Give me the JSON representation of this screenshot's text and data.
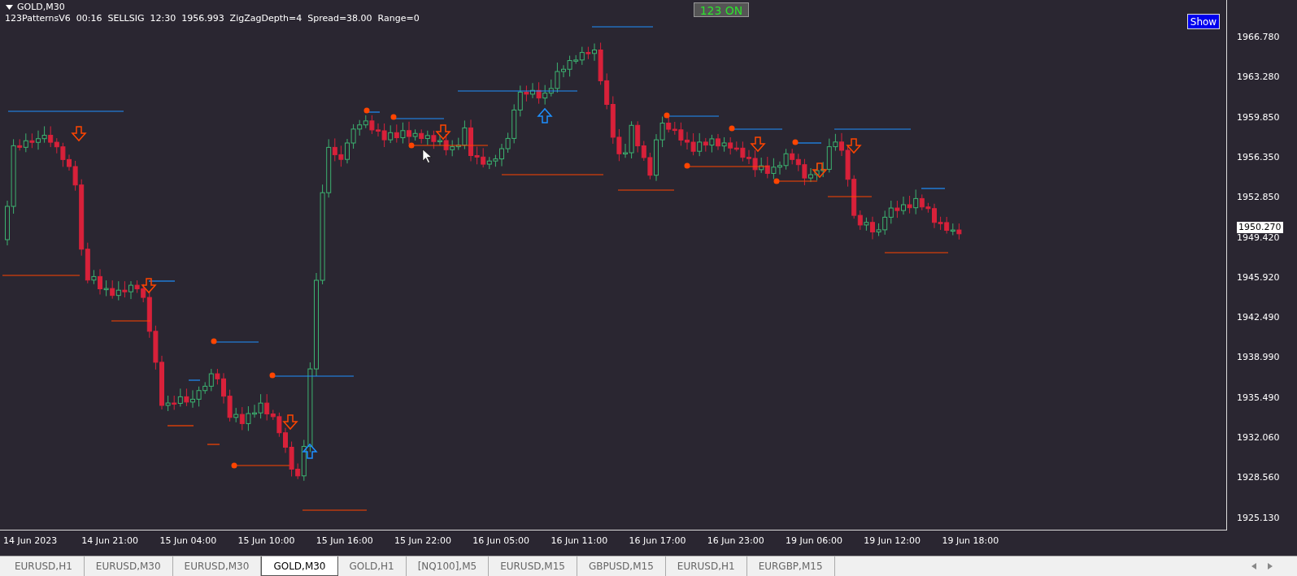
{
  "chart": {
    "symbol": "GOLD,M30",
    "indicator_line": "123PatternsV6  00:16  SELLSIG  12:30  1956.993  ZigZagDepth=4  Spread=38.00  Range=0",
    "status_badge": "123 ON",
    "show_button": "Show",
    "price_ticks": [
      "1966.780",
      "1963.280",
      "1959.850",
      "1956.350",
      "1952.850",
      "1949.420",
      "1945.920",
      "1942.490",
      "1938.990",
      "1935.490",
      "1932.060",
      "1928.560",
      "1925.130"
    ],
    "current_price": "1950.270",
    "time_ticks": [
      "14 Jun 2023",
      "14 Jun 21:00",
      "15 Jun 04:00",
      "15 Jun 10:00",
      "15 Jun 16:00",
      "15 Jun 22:00",
      "16 Jun 05:00",
      "16 Jun 11:00",
      "16 Jun 17:00",
      "16 Jun 23:00",
      "19 Jun 06:00",
      "19 Jun 12:00",
      "19 Jun 18:00"
    ]
  },
  "tabs": [
    {
      "label": "EURUSD,H1",
      "selected": false
    },
    {
      "label": "EURUSD,M30",
      "selected": false
    },
    {
      "label": "EURUSD,M30",
      "selected": false
    },
    {
      "label": "GOLD,M30",
      "selected": true
    },
    {
      "label": "GOLD,H1",
      "selected": false
    },
    {
      "label": "[NQ100],M5",
      "selected": false
    },
    {
      "label": "EURUSD,M15",
      "selected": false
    },
    {
      "label": "GBPUSD,M15",
      "selected": false
    },
    {
      "label": "EURUSD,H1",
      "selected": false
    },
    {
      "label": "EURGBP,M15",
      "selected": false
    }
  ]
}
